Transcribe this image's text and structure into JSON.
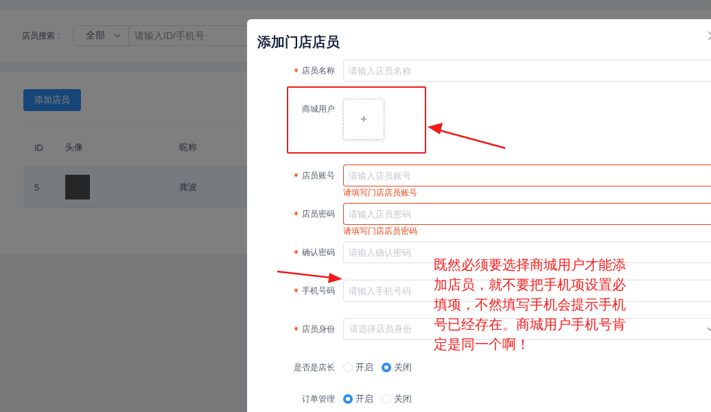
{
  "background": {
    "search": {
      "label": "店员搜索：",
      "scope": "全部",
      "placeholder": "请输入ID/手机号"
    },
    "add_button": "添加店员",
    "table": {
      "columns": [
        "ID",
        "头像",
        "昵称"
      ],
      "rows": [
        {
          "id": "5",
          "nickname": "龚波"
        }
      ]
    }
  },
  "dialog": {
    "title": "添加门店店员",
    "fields": [
      {
        "kind": "text",
        "label": "店员名称",
        "required": true,
        "placeholder": "请输入店员名称"
      },
      {
        "kind": "upload",
        "label": "商城用户",
        "required": false,
        "icon": "+"
      },
      {
        "kind": "text",
        "label": "店员账号",
        "required": true,
        "placeholder": "请输入店员账号",
        "error": "请填写门店店员账号"
      },
      {
        "kind": "text",
        "label": "店员密码",
        "required": true,
        "placeholder": "请输入店员密码",
        "error": "请填写门店店员密码"
      },
      {
        "kind": "text",
        "label": "确认密码",
        "required": true,
        "placeholder": "请输入确认密码"
      },
      {
        "kind": "text",
        "label": "手机号码",
        "required": true,
        "placeholder": "请输入手机号码"
      },
      {
        "kind": "select",
        "label": "店员身份",
        "required": true,
        "placeholder": "请选择店员身份"
      },
      {
        "kind": "radio",
        "label": "是否是店长",
        "required": false,
        "options": [
          {
            "label": "开启",
            "selected": false
          },
          {
            "label": "关闭",
            "selected": true
          }
        ]
      },
      {
        "kind": "radio",
        "label": "订单管理",
        "required": false,
        "options": [
          {
            "label": "开启",
            "selected": true
          },
          {
            "label": "关闭",
            "selected": false
          }
        ]
      }
    ]
  },
  "annotation": {
    "note": "既然必须要选择商城用户才能添加店员，就不要把手机项设置必填项，不然填写手机会提示手机号已经存在。商城用户手机号肯定是同一个啊！"
  }
}
